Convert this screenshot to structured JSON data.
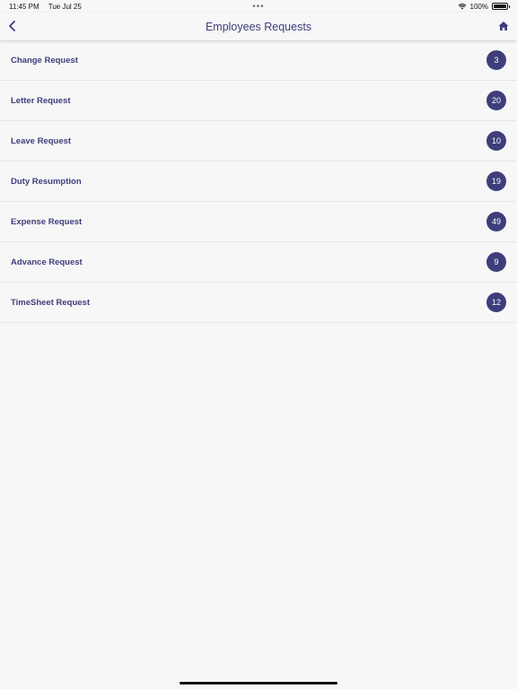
{
  "status": {
    "time": "11:45 PM",
    "date": "Tue Jul 25",
    "dots": "•••",
    "battery": "100%"
  },
  "navbar": {
    "title": "Employees Requests",
    "back_icon": "chevron-left-icon",
    "home_icon": "home-icon"
  },
  "requests": [
    {
      "label": "Change Request",
      "count": "3"
    },
    {
      "label": "Letter Request",
      "count": "20"
    },
    {
      "label": "Leave Request",
      "count": "10"
    },
    {
      "label": "Duty Resumption",
      "count": "19"
    },
    {
      "label": "Expense Request",
      "count": "49"
    },
    {
      "label": "Advance Request",
      "count": "9"
    },
    {
      "label": "TimeSheet Request",
      "count": "12"
    }
  ],
  "colors": {
    "accent": "#3f3e7b",
    "background": "#f7f7f8"
  }
}
